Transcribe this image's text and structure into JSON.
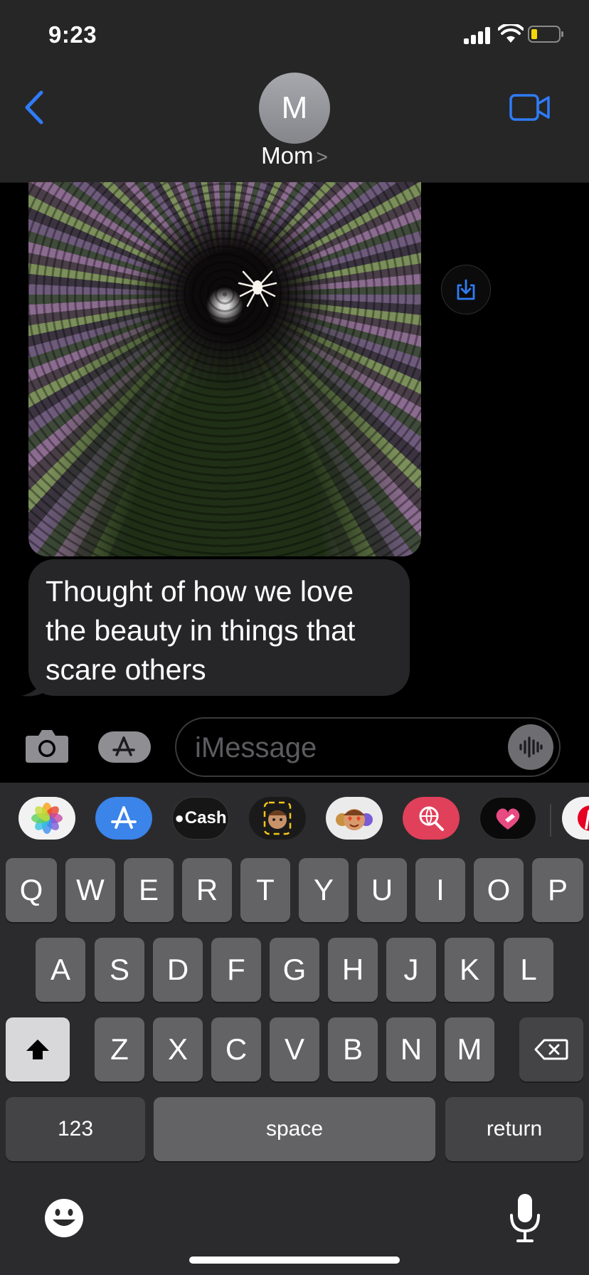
{
  "status": {
    "time": "9:23"
  },
  "header": {
    "avatar_initial": "M",
    "contact_name": "Mom",
    "chevron": ">"
  },
  "conversation": {
    "image_description": "spider-web-photo",
    "message_text": "Thought of how we love the beauty in things that scare others"
  },
  "compose": {
    "placeholder": "iMessage"
  },
  "app_drawer": {
    "apps": [
      {
        "name": "photos",
        "label": ""
      },
      {
        "name": "app-store",
        "label": ""
      },
      {
        "name": "apple-cash",
        "label": "Cash"
      },
      {
        "name": "memoji-stickers",
        "label": ""
      },
      {
        "name": "animoji",
        "label": ""
      },
      {
        "name": "web-images-search",
        "label": ""
      },
      {
        "name": "digital-touch",
        "label": ""
      },
      {
        "name": "pinterest",
        "label": ""
      }
    ]
  },
  "keyboard": {
    "row1": [
      "Q",
      "W",
      "E",
      "R",
      "T",
      "Y",
      "U",
      "I",
      "O",
      "P"
    ],
    "row2": [
      "A",
      "S",
      "D",
      "F",
      "G",
      "H",
      "J",
      "K",
      "L"
    ],
    "row3": [
      "Z",
      "X",
      "C",
      "V",
      "B",
      "N",
      "M"
    ],
    "numbers_label": "123",
    "space_label": "space",
    "return_label": "return"
  },
  "colors": {
    "accent": "#2f7cf6",
    "battery": "#f5d60a",
    "bubble": "#262628",
    "key": "#636366"
  }
}
